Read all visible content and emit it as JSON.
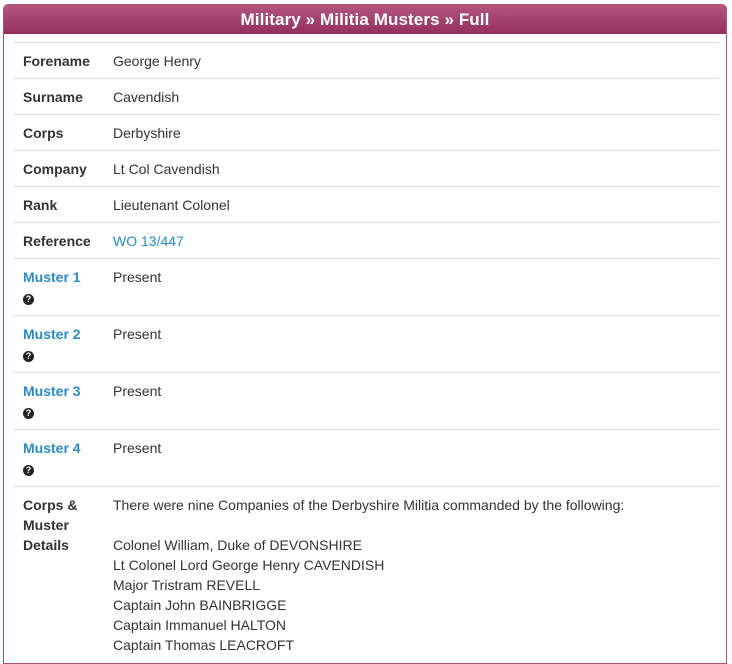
{
  "header": {
    "title": "Military » Militia Musters » Full"
  },
  "record": {
    "rows": [
      {
        "label": "Forename",
        "value": "George Henry"
      },
      {
        "label": "Surname",
        "value": "Cavendish"
      },
      {
        "label": "Corps",
        "value": "Derbyshire"
      },
      {
        "label": "Company",
        "value": "Lt Col Cavendish"
      },
      {
        "label": "Rank",
        "value": "Lieutenant Colonel"
      },
      {
        "label": "Reference",
        "value": "WO 13/447"
      }
    ],
    "musters": [
      {
        "label": "Muster 1",
        "value": "Present"
      },
      {
        "label": "Muster 2",
        "value": "Present"
      },
      {
        "label": "Muster 3",
        "value": "Present"
      },
      {
        "label": "Muster 4",
        "value": "Present"
      }
    ],
    "help_icon_glyph": "?",
    "details": {
      "label_line1": "Corps &",
      "label_line2": "Muster",
      "label_line3": "Details",
      "intro": "There were nine Companies of the Derbyshire Militia commanded by the following:",
      "officers": [
        "Colonel William, Duke of DEVONSHIRE",
        "Lt Colonel Lord George Henry CAVENDISH",
        "Major Tristram REVELL",
        "Captain John BAINBRIGGE",
        "Captain Immanuel HALTON",
        "Captain Thomas LEACROFT"
      ]
    }
  },
  "colors": {
    "header_bg": "#a2416b",
    "link": "#2a8bc4",
    "border": "#dddddd"
  }
}
